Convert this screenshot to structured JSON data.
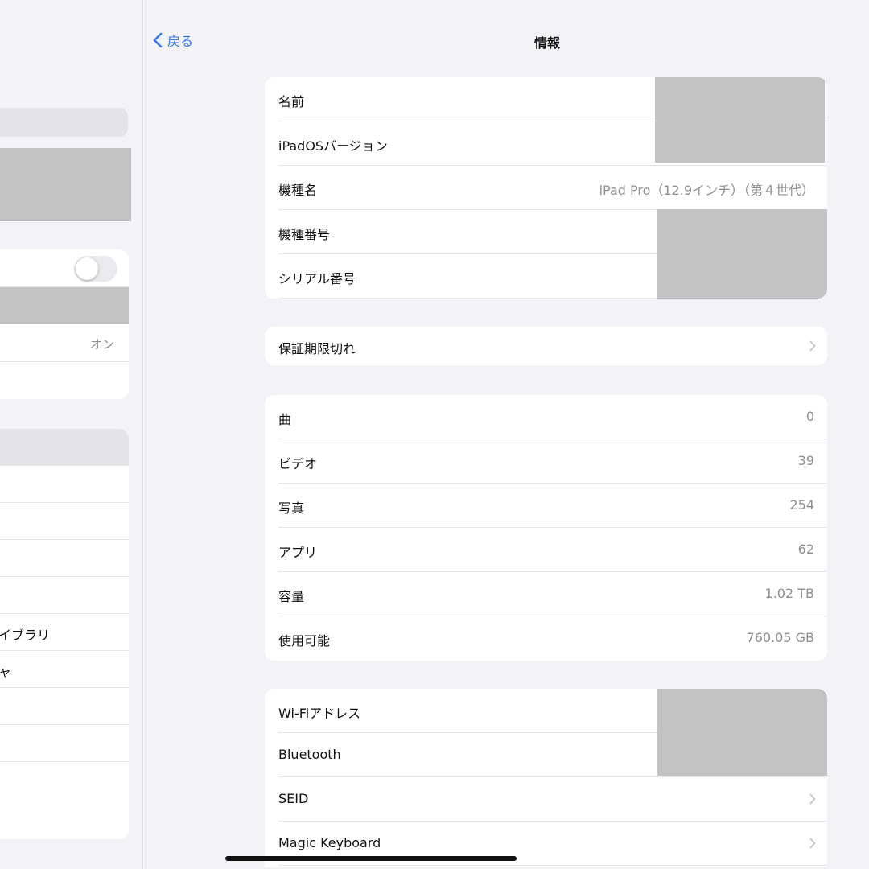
{
  "sidebar": {
    "toggle_row_value": "オン",
    "items": [
      "イブラリ",
      "ャ"
    ]
  },
  "nav": {
    "back_label": "戻る",
    "title": "情報"
  },
  "device_section": {
    "rows": [
      {
        "label": "名前"
      },
      {
        "label": "iPadOSバージョン"
      },
      {
        "label": "機種名",
        "value": "iPad Pro（12.9インチ）（第４世代）"
      },
      {
        "label": "機種番号"
      },
      {
        "label": "シリアル番号"
      }
    ]
  },
  "warranty_section": {
    "label": "保証期限切れ"
  },
  "media_section": {
    "rows": [
      {
        "label": "曲",
        "value": "0"
      },
      {
        "label": "ビデオ",
        "value": "39"
      },
      {
        "label": "写真",
        "value": "254"
      },
      {
        "label": "アプリ",
        "value": "62"
      },
      {
        "label": "容量",
        "value": "1.02 TB"
      },
      {
        "label": "使用可能",
        "value": "760.05 GB"
      }
    ]
  },
  "network_section": {
    "rows": [
      {
        "label": "Wi-Fiアドレス"
      },
      {
        "label": "Bluetooth"
      },
      {
        "label": "SEID"
      },
      {
        "label": "Magic Keyboard"
      }
    ]
  },
  "colors": {
    "accent": "#3478f6",
    "background": "#f2f2f7",
    "secondary_text": "#8e8e93",
    "redaction": "#c2c2c2"
  },
  "icons": {
    "back": "chevron-left-icon",
    "disclosure": "chevron-right-icon"
  }
}
